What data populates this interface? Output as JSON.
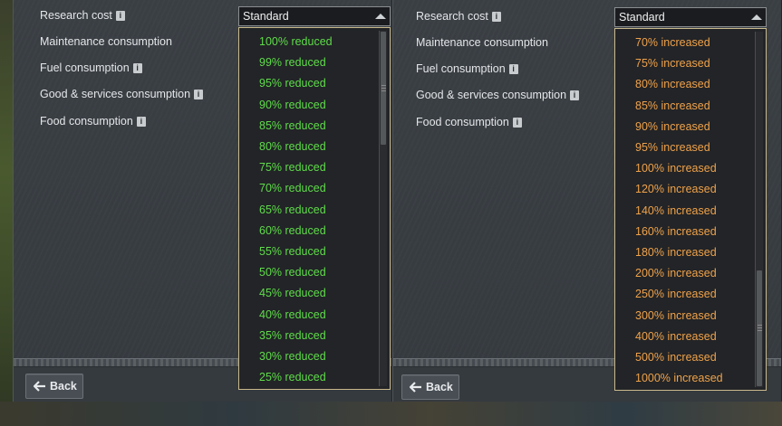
{
  "left": {
    "settings": [
      {
        "label": "Research cost",
        "info": true
      },
      {
        "label": "Maintenance consumption",
        "info": false
      },
      {
        "label": "Fuel consumption",
        "info": true
      },
      {
        "label": "Good & services consumption",
        "info": true
      },
      {
        "label": "Food consumption",
        "info": true
      }
    ],
    "select_value": "Standard",
    "dropdown_options": [
      "100% reduced",
      "99% reduced",
      "95% reduced",
      "90% reduced",
      "85% reduced",
      "80% reduced",
      "75% reduced",
      "70% reduced",
      "65% reduced",
      "60% reduced",
      "55% reduced",
      "50% reduced",
      "45% reduced",
      "40% reduced",
      "35% reduced",
      "30% reduced",
      "25% reduced"
    ],
    "back_label": "Back"
  },
  "right": {
    "settings": [
      {
        "label": "Research cost",
        "info": true
      },
      {
        "label": "Maintenance consumption",
        "info": false
      },
      {
        "label": "Fuel consumption",
        "info": true
      },
      {
        "label": "Good & services consumption",
        "info": true
      },
      {
        "label": "Food consumption",
        "info": true
      }
    ],
    "select_value": "Standard",
    "dropdown_options": [
      "70% increased",
      "75% increased",
      "80% increased",
      "85% increased",
      "90% increased",
      "95% increased",
      "100% increased",
      "120% increased",
      "140% increased",
      "160% increased",
      "180% increased",
      "200% increased",
      "250% increased",
      "300% increased",
      "400% increased",
      "500% increased",
      "1000% increased"
    ],
    "back_label": "Back"
  },
  "colors": {
    "reduced": "#5fdc4a",
    "increased": "#f0a24a",
    "dropdown_border": "#c9b98c"
  },
  "info_icon_glyph": "i"
}
